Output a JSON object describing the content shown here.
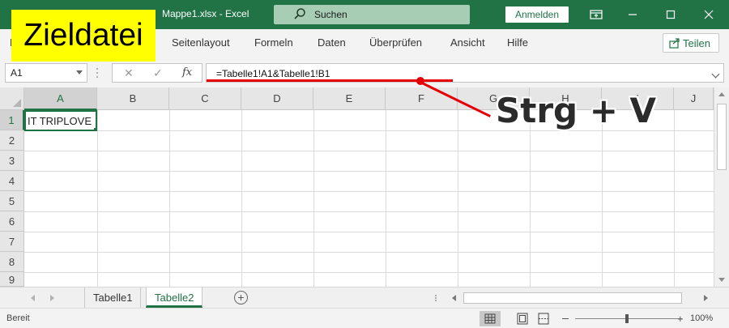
{
  "window": {
    "title": "Mappe1.xlsx  -  Excel",
    "search_label": "Suchen",
    "signin_label": "Anmelden",
    "accent_color": "#217346"
  },
  "ribbon": {
    "tabs": [
      {
        "label": "D"
      },
      {
        "label": "Seitenlayout"
      },
      {
        "label": "Formeln"
      },
      {
        "label": "Daten"
      },
      {
        "label": "Überprüfen"
      },
      {
        "label": "Ansicht"
      },
      {
        "label": "Hilfe"
      }
    ],
    "share_label": "Teilen"
  },
  "formula_bar": {
    "name_box": "A1",
    "fx_label": "fx",
    "formula": "=Tabelle1!A1&Tabelle1!B1"
  },
  "grid": {
    "columns": [
      "A",
      "B",
      "C",
      "D",
      "E",
      "F",
      "G",
      "H",
      "I",
      "J"
    ],
    "rows": [
      "1",
      "2",
      "3",
      "4",
      "5",
      "6",
      "7",
      "8",
      "9"
    ],
    "active_cell_value": "IT TRIPLOVE"
  },
  "sheets": {
    "tabs": [
      {
        "label": "Tabelle1",
        "active": false
      },
      {
        "label": "Tabelle2",
        "active": true
      }
    ],
    "add_label": "+"
  },
  "status": {
    "text": "Bereit",
    "zoom_plus": "+",
    "zoom_level": "100%"
  },
  "annotation": {
    "label": "Zieldatei",
    "shortcut": "Strg + V",
    "highlight_color": "#ffff00",
    "marker_color": "#e60000"
  }
}
